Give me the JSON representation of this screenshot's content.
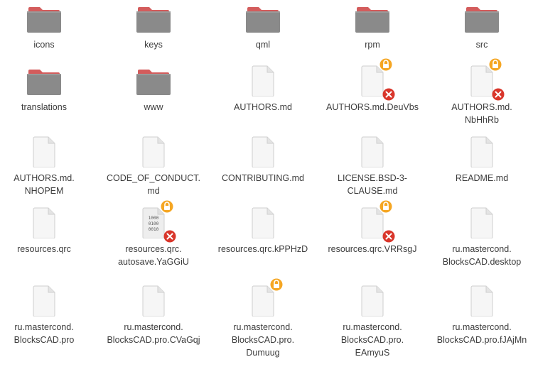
{
  "items": [
    {
      "name": "icons",
      "type": "folder"
    },
    {
      "name": "keys",
      "type": "folder"
    },
    {
      "name": "qml",
      "type": "folder"
    },
    {
      "name": "rpm",
      "type": "folder"
    },
    {
      "name": "src",
      "type": "folder"
    },
    {
      "name": "translations",
      "type": "folder"
    },
    {
      "name": "www",
      "type": "folder"
    },
    {
      "name": "AUTHORS.md",
      "type": "file"
    },
    {
      "name": "AUTHORS.md.DeuVbs",
      "type": "file",
      "locked": true,
      "unreadable": true
    },
    {
      "name": "AUTHORS.md.\nNbHhRb",
      "type": "file",
      "locked": true,
      "unreadable": true
    },
    {
      "name": "AUTHORS.md.\nNHOPEM",
      "type": "file"
    },
    {
      "name": "CODE_OF_CONDUCT.\nmd",
      "type": "file"
    },
    {
      "name": "CONTRIBUTING.md",
      "type": "file"
    },
    {
      "name": "LICENSE.BSD-3-\nCLAUSE.md",
      "type": "file"
    },
    {
      "name": "README.md",
      "type": "file"
    },
    {
      "name": "resources.qrc",
      "type": "file"
    },
    {
      "name": "resources.qrc.\nautosave.YaGGiU",
      "type": "binary",
      "locked": true,
      "unreadable": true
    },
    {
      "name": "resources.qrc.kPPHzD",
      "type": "file"
    },
    {
      "name": "resources.qrc.VRRsgJ",
      "type": "file",
      "locked": true,
      "unreadable": true
    },
    {
      "name": "ru.mastercond.\nBlocksCAD.desktop",
      "type": "file"
    },
    {
      "name": "ru.mastercond.\nBlocksCAD.pro",
      "type": "file"
    },
    {
      "name": "ru.mastercond.\nBlocksCAD.pro.CVaGqj",
      "type": "file"
    },
    {
      "name": "ru.mastercond.\nBlocksCAD.pro.\nDumuug",
      "type": "file",
      "locked": true
    },
    {
      "name": "ru.mastercond.\nBlocksCAD.pro.\nEAmyuS",
      "type": "file"
    },
    {
      "name": "ru.mastercond.\nBlocksCAD.pro.fJAjMn",
      "type": "file"
    }
  ],
  "binary_glyph_text": [
    "1000",
    "0100",
    "0010"
  ],
  "colors": {
    "folder_body": "#8a8a8a",
    "folder_tab": "#d35c5c",
    "lock_badge": "#f5a623",
    "error_badge": "#d9362b",
    "text": "#3c3c3c"
  }
}
